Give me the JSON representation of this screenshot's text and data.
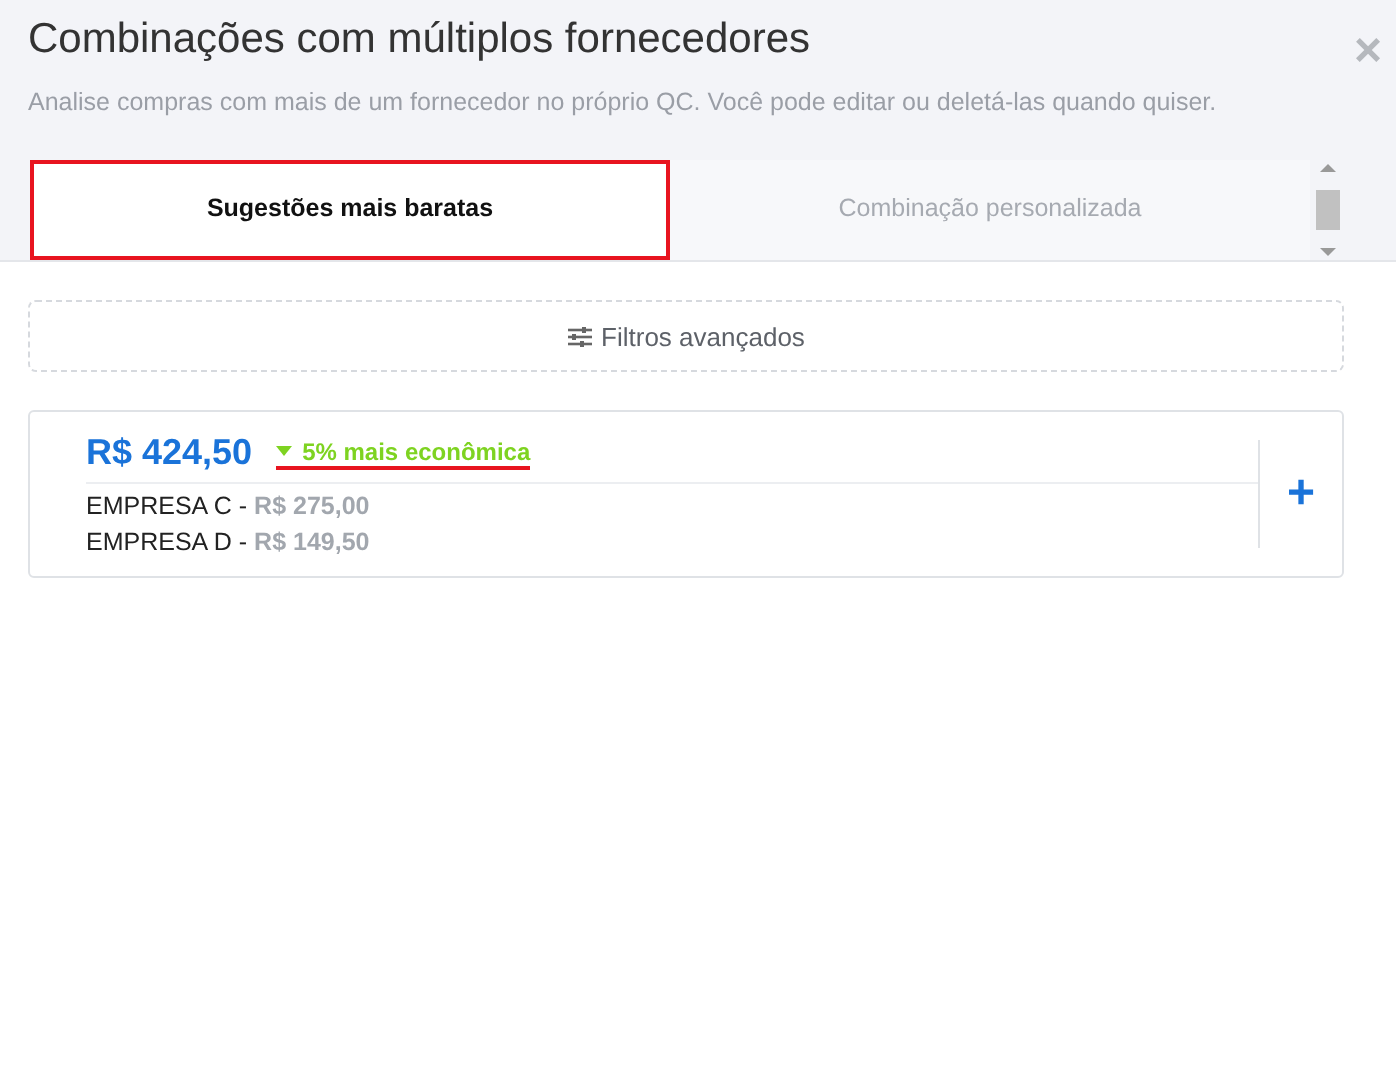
{
  "modal": {
    "title": "Combinações com múltiplos fornecedores",
    "subtitle": "Analise compras com mais de um fornecedor no próprio QC. Você pode editar ou deletá-las quando quiser.",
    "close": "×"
  },
  "tabs": [
    {
      "label": "Sugestões mais baratas",
      "selected": true
    },
    {
      "label": "Combinação personalizada",
      "selected": false
    }
  ],
  "filters_button": "Filtros avançados",
  "suggestions": [
    {
      "total": "R$ 424,50",
      "savings": "5% mais econômica",
      "suppliers": [
        {
          "name": "EMPRESA C - ",
          "price": "R$ 275,00"
        },
        {
          "name": "EMPRESA D - ",
          "price": "R$ 149,50"
        }
      ],
      "add": "+"
    }
  ]
}
